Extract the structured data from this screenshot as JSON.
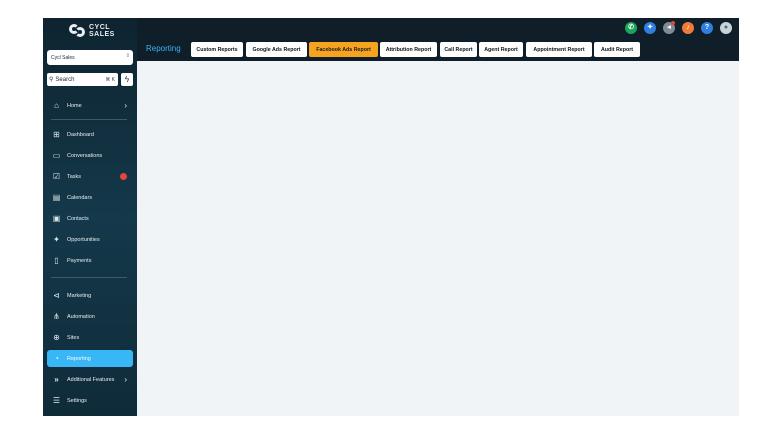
{
  "brand": {
    "line1": "CYCL",
    "line2": "SALES"
  },
  "account": {
    "name": "Cycl Sales"
  },
  "search": {
    "label": "Search",
    "shortcut": "⌘ K"
  },
  "sidebar": {
    "items": [
      {
        "label": "Home",
        "icon": "home-icon"
      },
      {
        "label": "Dashboard",
        "icon": "dashboard-icon"
      },
      {
        "label": "Conversations",
        "icon": "chat-icon"
      },
      {
        "label": "Tasks",
        "icon": "tasks-icon"
      },
      {
        "label": "Calendars",
        "icon": "calendar-icon"
      },
      {
        "label": "Contacts",
        "icon": "contacts-icon"
      },
      {
        "label": "Opportunities",
        "icon": "opportunities-icon"
      },
      {
        "label": "Payments",
        "icon": "payments-icon"
      },
      {
        "label": "Marketing",
        "icon": "megaphone-icon"
      },
      {
        "label": "Automation",
        "icon": "automation-icon"
      },
      {
        "label": "Sites",
        "icon": "globe-icon"
      },
      {
        "label": "Reporting",
        "icon": "reporting-icon"
      },
      {
        "label": "Additional Features",
        "icon": "double-chevron-icon"
      },
      {
        "label": "Settings",
        "icon": "settings-icon"
      }
    ]
  },
  "header": {
    "title": "Reporting",
    "tabs": [
      {
        "label": "Custom Reports"
      },
      {
        "label": "Google Ads Report"
      },
      {
        "label": "Facebook Ads Report"
      },
      {
        "label": "Attribution Report"
      },
      {
        "label": "Call Report"
      },
      {
        "label": "Agent Report"
      },
      {
        "label": "Appointment Report"
      },
      {
        "label": "Audit Report"
      }
    ],
    "active_tab": "Facebook Ads Report",
    "actions": [
      {
        "icon": "phone-icon",
        "color": "#1aa55a"
      },
      {
        "icon": "sparkle-icon",
        "color": "#2f7fe0"
      },
      {
        "icon": "megaphone-icon",
        "color": "#7f8c95"
      },
      {
        "icon": "bell-icon",
        "color": "#f07a3a"
      },
      {
        "icon": "help-icon",
        "color": "#2f7fe0"
      },
      {
        "icon": "avatar",
        "color": "#c9d3da"
      }
    ]
  },
  "colors": {
    "accent": "#38b6f5",
    "active_tab": "#f6a41f",
    "sidebar": "#14394a",
    "badge": "#e7453c"
  }
}
